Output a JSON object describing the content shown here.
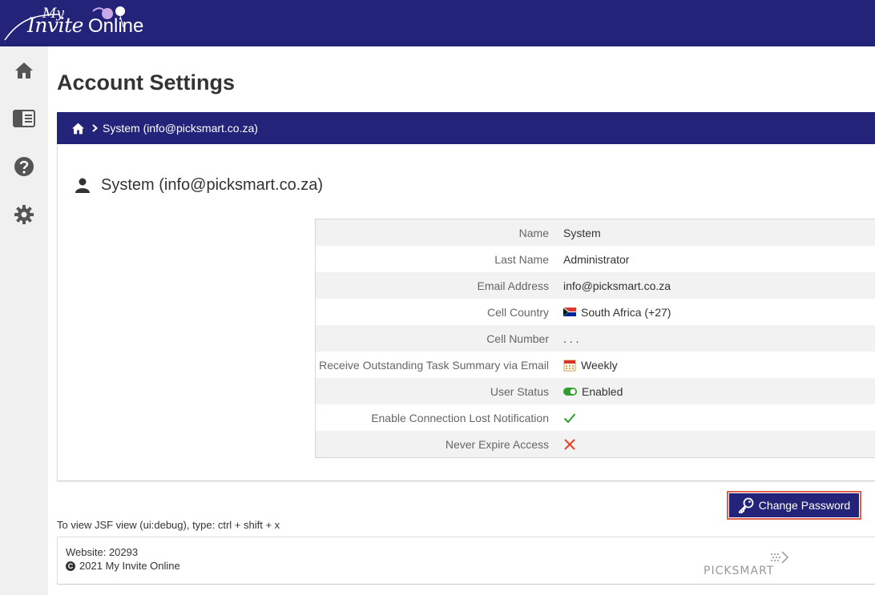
{
  "header": {
    "logo": {
      "my": "My",
      "invite": "Invite",
      "online": "Online"
    }
  },
  "sidebar": {
    "items": [
      {
        "icon": "home-icon"
      },
      {
        "icon": "panel-icon"
      },
      {
        "icon": "help-icon"
      },
      {
        "icon": "gear-icon"
      }
    ]
  },
  "page": {
    "title": "Account Settings"
  },
  "breadcrumb": {
    "current": "System (info@picksmart.co.za)"
  },
  "user": {
    "display_name": "System (info@picksmart.co.za)"
  },
  "details": [
    {
      "label": "Name",
      "value": "System"
    },
    {
      "label": "Last Name",
      "value": "Administrator"
    },
    {
      "label": "Email Address",
      "value": "info@picksmart.co.za"
    },
    {
      "label": "Cell Country",
      "value": "South Africa (+27)",
      "icon": "flag-za-icon"
    },
    {
      "label": "Cell Number",
      "value": ". . ."
    },
    {
      "label": "Receive Outstanding Task Summary via Email",
      "value": "Weekly",
      "icon": "calendar-icon"
    },
    {
      "label": "User Status",
      "value": "Enabled",
      "icon": "toggle-on-icon"
    },
    {
      "label": "Enable Connection Lost Notification",
      "value": "",
      "icon": "check-icon"
    },
    {
      "label": "Never Expire Access",
      "value": "",
      "icon": "cross-icon"
    }
  ],
  "actions": {
    "change_password": "Change Password"
  },
  "hint": "To view JSF view (ui:debug), type: ctrl + shift + x",
  "footer": {
    "website": "Website: 20293",
    "copyright": "2021 My Invite Online",
    "brand": "PICKSMART"
  },
  "colors": {
    "primary": "#23237a",
    "highlight": "#e0604f",
    "check": "#2e9e2e",
    "cross": "#e8402a"
  }
}
